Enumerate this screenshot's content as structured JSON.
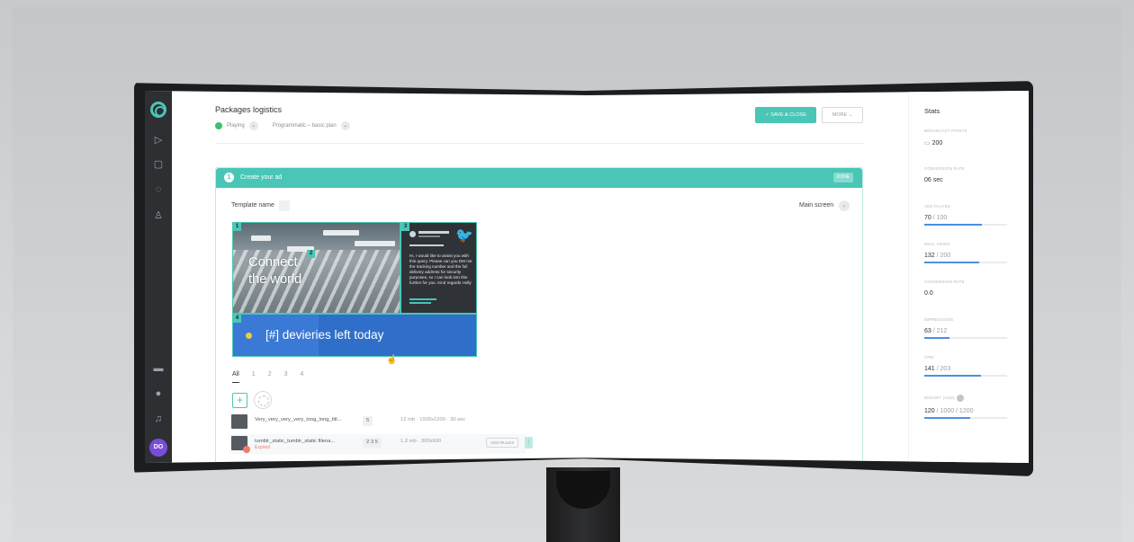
{
  "app": {
    "page_title": "Packages logistics",
    "status": "Playing",
    "plan": "Programmatic – basic plan",
    "save_label": "SAVE & CLOSE",
    "more_label": "MORE"
  },
  "nav": {
    "avatar_initials": "DO",
    "icons": [
      "logo-icon",
      "play-icon",
      "document-icon",
      "broadcast-icon",
      "user-icon",
      "monitor-icon",
      "help-icon",
      "notification-icon"
    ]
  },
  "card": {
    "step_number": "1",
    "title": "Create your ad",
    "header_button": "DONE",
    "template_label": "Template name",
    "screen_label": "Main screen"
  },
  "preview": {
    "zone_badges": [
      "1",
      "2",
      "3",
      "4"
    ],
    "headline_line1": "Connect",
    "headline_line2": "the world",
    "tweet_text": "Hi, I would like to assist you with this query. Please can you DM me the tracking number and the full delivery address for security purposes, so I can look into this further for you. Kind regards Holly",
    "delivery_text": "[#] devieries left today"
  },
  "tabs": [
    "All",
    "1",
    "2",
    "3",
    "4"
  ],
  "rows": [
    {
      "name": "Very_very_very_very_long_long_titl...",
      "chip": "5",
      "meta": "12 mb · 1920x1200 · 30 sec"
    },
    {
      "name": "tumblr_static_tumblr_static filena...",
      "sub": "Expired",
      "chip": "2 3 5",
      "meta": "1.2 mb · 300x600",
      "add_rule": "ADD RULES"
    }
  ],
  "stats": {
    "title": "Stats",
    "items": [
      {
        "label": "BROADCAST POINTS",
        "value": "200"
      },
      {
        "label": "CONVERSION RATE",
        "value": "06 sec"
      },
      {
        "label": "ADS PLAYED",
        "value": "70",
        "total": "/ 100",
        "progress": 0.7
      },
      {
        "label": "REAL VIEWS",
        "value": "132",
        "total": "/ 200",
        "progress": 0.66
      },
      {
        "label": "CONVERSION RATE",
        "value": "0.0"
      },
      {
        "label": "IMPRESSIONS",
        "value": "63",
        "total": "/ 212",
        "progress": 0.3
      },
      {
        "label": "CPM",
        "value": "141",
        "total": "/ 203",
        "progress": 0.69
      },
      {
        "label": "BUDGET (USD)",
        "value": "120",
        "total": "/ 1000 / 1200",
        "progress": 0.55
      }
    ]
  },
  "colors": {
    "accent": "#49c6b5",
    "nav_bg": "#2d2f33",
    "blue": "#2f6fca",
    "status_green": "#3bc36b",
    "avatar": "#7a4dd8"
  }
}
